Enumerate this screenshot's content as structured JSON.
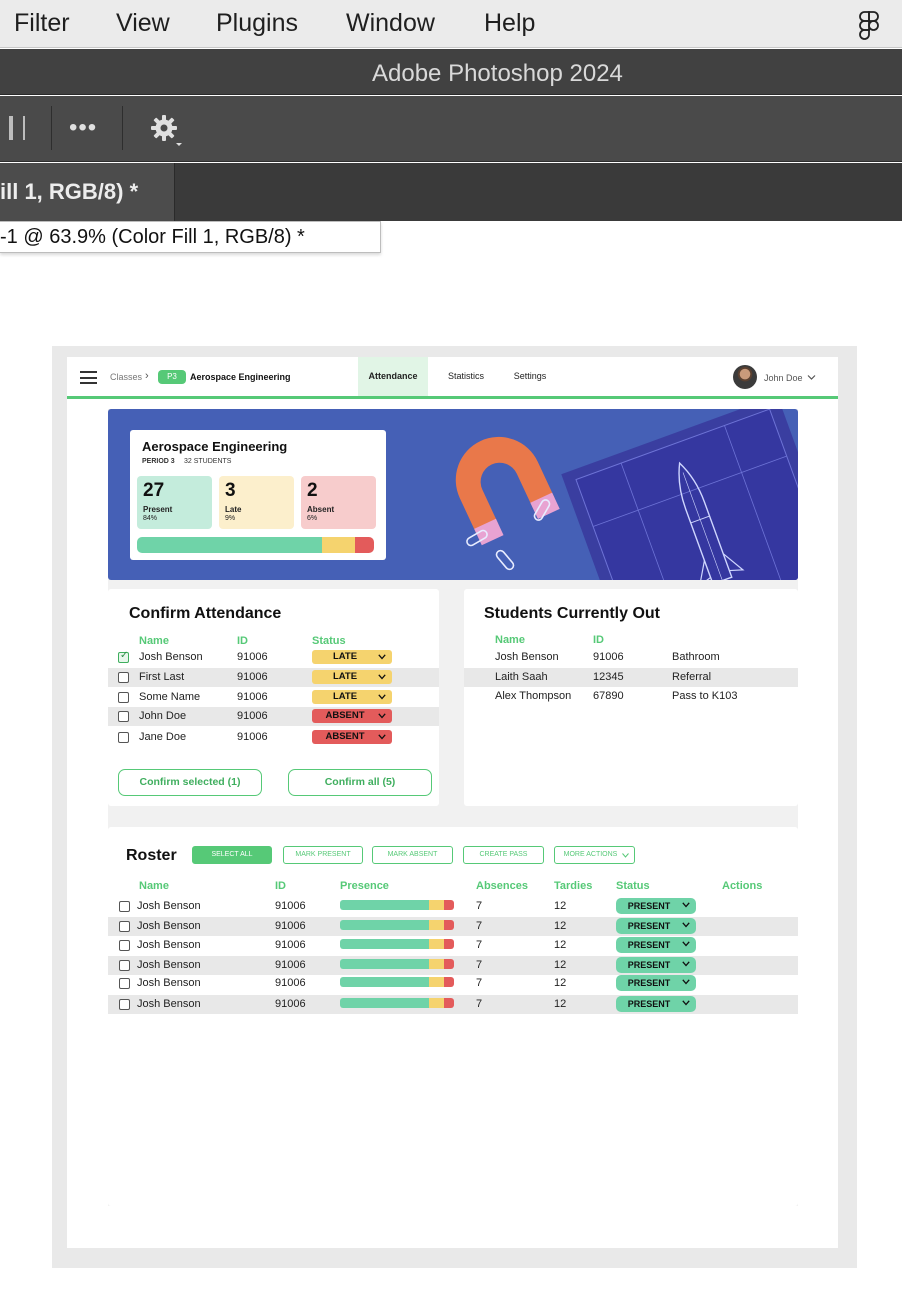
{
  "menubar": {
    "items": [
      "Filter",
      "View",
      "Plugins",
      "Window",
      "Help"
    ],
    "right_icon": "figma-icon"
  },
  "photoshop": {
    "title": "Adobe Photoshop 2024",
    "options_more": "•••",
    "tab_label": "ill 1, RGB/8) *",
    "doc_label": "-1 @ 63.9% (Color Fill 1, RGB/8) *"
  },
  "nav": {
    "breadcrumb": "Classes",
    "period_badge": "P3",
    "course": "Aerospace Engineering",
    "tabs": [
      "Attendance",
      "Statistics",
      "Settings"
    ],
    "active_tab": "Attendance",
    "user": "John Doe"
  },
  "summary": {
    "title": "Aerospace Engineering",
    "period": "PERIOD 3",
    "students": "32 STUDENTS",
    "present": {
      "count": "27",
      "label": "Present",
      "pct": "84%"
    },
    "late": {
      "count": "3",
      "label": "Late",
      "pct": "9%"
    },
    "absent": {
      "count": "2",
      "label": "Absent",
      "pct": "6%"
    },
    "bar_fractions": {
      "present": 0.78,
      "late": 0.14,
      "absent": 0.08
    }
  },
  "confirm": {
    "title": "Confirm Attendance",
    "headers": {
      "name": "Name",
      "id": "ID",
      "status": "Status"
    },
    "rows": [
      {
        "name": "Josh Benson",
        "id": "91006",
        "status": "LATE",
        "checked": true
      },
      {
        "name": "First Last",
        "id": "91006",
        "status": "LATE",
        "checked": false
      },
      {
        "name": "Some Name",
        "id": "91006",
        "status": "LATE",
        "checked": false
      },
      {
        "name": "John Doe",
        "id": "91006",
        "status": "ABSENT",
        "checked": false
      },
      {
        "name": "Jane Doe",
        "id": "91006",
        "status": "ABSENT",
        "checked": false
      }
    ],
    "btn_selected": "Confirm selected (1)",
    "btn_all": "Confirm all (5)"
  },
  "out": {
    "title": "Students Currently Out",
    "headers": {
      "name": "Name",
      "id": "ID"
    },
    "rows": [
      {
        "name": "Josh Benson",
        "id": "91006",
        "where": "Bathroom"
      },
      {
        "name": "Laith Saah",
        "id": "12345",
        "where": "Referral"
      },
      {
        "name": "Alex Thompson",
        "id": "67890",
        "where": "Pass to K103"
      }
    ]
  },
  "roster": {
    "title": "Roster",
    "buttons": {
      "select_all": "SELECT ALL",
      "mark_present": "MARK PRESENT",
      "mark_absent": "MARK ABSENT",
      "create_pass": "CREATE PASS",
      "more_actions": "MORE ACTIONS"
    },
    "headers": {
      "name": "Name",
      "id": "ID",
      "presence": "Presence",
      "absences": "Absences",
      "tardies": "Tardies",
      "status": "Status",
      "actions": "Actions"
    },
    "rows": [
      {
        "name": "Josh Benson",
        "id": "91006",
        "absences": "7",
        "tardies": "12",
        "status": "PRESENT",
        "presence": {
          "present": 0.78,
          "late": 0.13,
          "absent": 0.09
        }
      },
      {
        "name": "Josh Benson",
        "id": "91006",
        "absences": "7",
        "tardies": "12",
        "status": "PRESENT",
        "presence": {
          "present": 0.78,
          "late": 0.13,
          "absent": 0.09
        }
      },
      {
        "name": "Josh Benson",
        "id": "91006",
        "absences": "7",
        "tardies": "12",
        "status": "PRESENT",
        "presence": {
          "present": 0.78,
          "late": 0.13,
          "absent": 0.09
        }
      },
      {
        "name": "Josh Benson",
        "id": "91006",
        "absences": "7",
        "tardies": "12",
        "status": "PRESENT",
        "presence": {
          "present": 0.78,
          "late": 0.13,
          "absent": 0.09
        }
      },
      {
        "name": "Josh Benson",
        "id": "91006",
        "absences": "7",
        "tardies": "12",
        "status": "PRESENT",
        "presence": {
          "present": 0.78,
          "late": 0.13,
          "absent": 0.09
        }
      },
      {
        "name": "Josh Benson",
        "id": "91006",
        "absences": "7",
        "tardies": "12",
        "status": "PRESENT",
        "presence": {
          "present": 0.78,
          "late": 0.13,
          "absent": 0.09
        }
      }
    ]
  },
  "colors": {
    "accent_green": "#56c977",
    "present": "#6fd3a8",
    "late": "#f5d36e",
    "absent": "#e35b5b",
    "hero_blue": "#4560b6"
  }
}
